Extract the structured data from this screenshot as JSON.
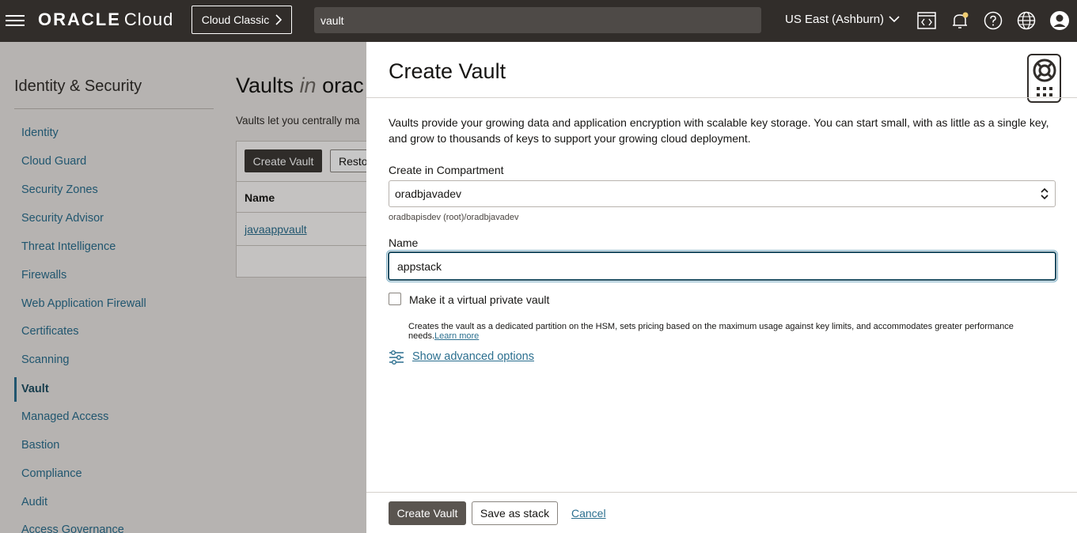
{
  "topbar": {
    "brand_oracle": "ORACLE",
    "brand_cloud": "Cloud",
    "classic_label": "Cloud Classic",
    "search_value": "vault",
    "region": "US East (Ashburn)",
    "icons": [
      "code-editor-icon",
      "bell-icon",
      "help-icon",
      "globe-icon",
      "user-icon"
    ]
  },
  "sidebar": {
    "title": "Identity & Security",
    "items": [
      {
        "label": "Identity"
      },
      {
        "label": "Cloud Guard"
      },
      {
        "label": "Security Zones"
      },
      {
        "label": "Security Advisor"
      },
      {
        "label": "Threat Intelligence"
      },
      {
        "label": "Firewalls"
      },
      {
        "label": "Web Application Firewall"
      },
      {
        "label": "Certificates"
      },
      {
        "label": "Scanning"
      },
      {
        "label": "Vault",
        "active": true
      },
      {
        "label": "Managed Access"
      },
      {
        "label": "Bastion"
      },
      {
        "label": "Compliance"
      },
      {
        "label": "Audit"
      },
      {
        "label": "Access Governance"
      }
    ]
  },
  "main": {
    "title_prefix": "Vaults",
    "title_in": "in",
    "title_suffix": "orac",
    "description": "Vaults let you centrally ma",
    "create_button": "Create Vault",
    "restore_button": "Resto",
    "column_name": "Name",
    "rows": [
      {
        "name": "javaappvault"
      }
    ]
  },
  "drawer": {
    "title": "Create Vault",
    "description": "Vaults provide your growing data and application encryption with scalable key storage. You can start small, with as little as a single key, and grow to thousands of keys to support your growing cloud deployment.",
    "compartment_label": "Create in Compartment",
    "compartment_value": "oradbjavadev",
    "compartment_path": "oradbapisdev (root)/oradbjavadev",
    "name_label": "Name",
    "name_value": "appstack",
    "virtual_private_label": "Make it a virtual private vault",
    "virtual_private_checked": false,
    "virtual_private_help": "Creates the vault as a dedicated partition on the HSM, sets pricing based on the maximum usage against key limits, and accommodates greater performance needs.",
    "learn_more": "Learn more",
    "advanced_link": "Show advanced options",
    "create_button": "Create Vault",
    "save_stack_button": "Save as stack",
    "cancel_link": "Cancel"
  }
}
